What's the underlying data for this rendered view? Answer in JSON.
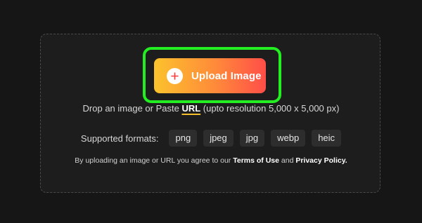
{
  "upload": {
    "button_label": "Upload Image",
    "icon": "plus-icon",
    "highlight_color": "#22ee22",
    "gradient": [
      "#fcc22d",
      "#ff8a3a",
      "#ff4e48"
    ]
  },
  "drop": {
    "prefix": "Drop an image or Paste ",
    "url_link": "URL",
    "suffix": " (upto resolution 5,000 x 5,000 px)"
  },
  "formats": {
    "label": "Supported formats:",
    "items": [
      "png",
      "jpeg",
      "jpg",
      "webp",
      "heic"
    ]
  },
  "terms": {
    "prefix": "By uploading an image or URL you agree to our ",
    "terms_link": "Terms of Use",
    "middle": " and ",
    "privacy_link": "Privacy Policy."
  }
}
